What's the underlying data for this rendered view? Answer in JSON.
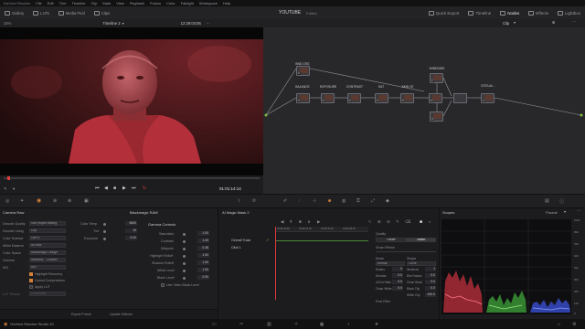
{
  "titlebar": {
    "app_title": "DaVinci Resolve",
    "menus": [
      "File",
      "Edit",
      "Trim",
      "Timeline",
      "Clip",
      "Mark",
      "View",
      "Playback",
      "Fusion",
      "Color",
      "Fairlight",
      "Workspace",
      "Help"
    ]
  },
  "toolbar": {
    "left_items": [
      "Gallery",
      "LUTs",
      "Media Pool",
      "Clips"
    ],
    "project_name": "YOUTUBE",
    "project_status": "Edited",
    "right_items": [
      "Quick Export",
      "Timeline",
      "Nodes",
      "Effects",
      "Lightbox"
    ]
  },
  "viewer": {
    "zoom": "34%",
    "timeline_name": "Timeline 2",
    "source_timecode": "12:29:04:05",
    "timecode": "01:01:14:14"
  },
  "node_editor": {
    "dropdown": "Clip",
    "nodes": [
      {
        "label": "BND CRG",
        "num": "01"
      },
      {
        "label": "BALANCE",
        "num": "02"
      },
      {
        "label": "EXPOSURE",
        "num": "03"
      },
      {
        "label": "CONTRAST",
        "num": "04"
      },
      {
        "label": "SAT",
        "num": "05"
      },
      {
        "label": "SKIN YE",
        "num": "06"
      },
      {
        "label": "WINDOWS",
        "num": "07"
      },
      {
        "label": "",
        "num": "08"
      },
      {
        "label": "",
        "num": "09"
      },
      {
        "label": "CST/LAL...",
        "num": "10"
      }
    ]
  },
  "camera_raw": {
    "title": "Camera Raw",
    "panel_title": "Blackmagic RAW",
    "rows": [
      {
        "label": "Decode Quality",
        "value": "Use project setting"
      },
      {
        "label": "Decode Using",
        "value": "Clip"
      },
      {
        "label": "Color Science",
        "value": "Gen 5"
      },
      {
        "label": "White Balance",
        "value": "As shot"
      },
      {
        "label": "Color Space",
        "value": "Blackmagic Design"
      },
      {
        "label": "Gamma",
        "value": "Blackma... Custom"
      },
      {
        "label": "ISO",
        "value": "800"
      }
    ],
    "right_fields": [
      {
        "label": "Color Temp",
        "value": "5600"
      },
      {
        "label": "Tint",
        "value": "10"
      },
      {
        "label": "Exposure",
        "value": "0.00"
      }
    ],
    "checkboxes": [
      "Highlight Recovery",
      "Gamut Compression",
      "Apply LUT"
    ],
    "lut_label": "LUT Source",
    "lut_value": "Embedded",
    "footer_buttons": [
      "Export Frame",
      "Update Sidecar"
    ]
  },
  "gamma_controls": {
    "title": "Gamma Controls",
    "rows": [
      {
        "label": "Saturation",
        "value": "1.00"
      },
      {
        "label": "Contrast",
        "value": "1.00"
      },
      {
        "label": "Midpoint",
        "value": "0.38"
      },
      {
        "label": "Highlight Rolloff",
        "value": "1.00"
      },
      {
        "label": "Shadow Rolloff",
        "value": "1.00"
      },
      {
        "label": "White Level",
        "value": "1.00"
      },
      {
        "label": "Black Level",
        "value": "0.00"
      }
    ],
    "checkbox": "Use Video Black Level"
  },
  "magic_mask": {
    "title": "AI Magic Mask 2",
    "tracks": [
      "Overall Track",
      "Click 1"
    ],
    "ruler": [
      "01:00:12:02",
      "01:00:14:02",
      "01:00:16:01",
      "01:00:18:01"
    ],
    "quality_label": "Quality",
    "quality_options": [
      "Faster",
      "Better"
    ],
    "refine_label": "Smart Refine",
    "mode_label": "Mode",
    "mode_value": "Animal",
    "shape_label": "Shape",
    "shape_value": "Circle",
    "params": [
      {
        "label": "Radius",
        "value": "0"
      },
      {
        "label": "Iterations",
        "value": "1"
      },
      {
        "label": "Denoise",
        "value": "0.0"
      },
      {
        "label": "Blur Radius",
        "value": "0.0"
      },
      {
        "label": "In/Out Ratio",
        "value": "0.0"
      },
      {
        "label": "Clean Black",
        "value": "0.0"
      },
      {
        "label": "Clean White",
        "value": "0.0"
      },
      {
        "label": "Black Clip",
        "value": "0.0"
      },
      {
        "label": "White Clip",
        "value": "100.0"
      }
    ],
    "post_label": "Post Filter"
  },
  "scopes": {
    "title": "Scopes",
    "type": "Parade",
    "scale": [
      "1023",
      "896",
      "768",
      "640",
      "512",
      "384",
      "256",
      "128",
      "0"
    ]
  },
  "bottombar": {
    "app_name": "DaVinci Resolve Studio 20"
  },
  "colors": {
    "accent": "#d3803b",
    "playhead": "#e03a3a",
    "skin_red": "#b3303a"
  }
}
